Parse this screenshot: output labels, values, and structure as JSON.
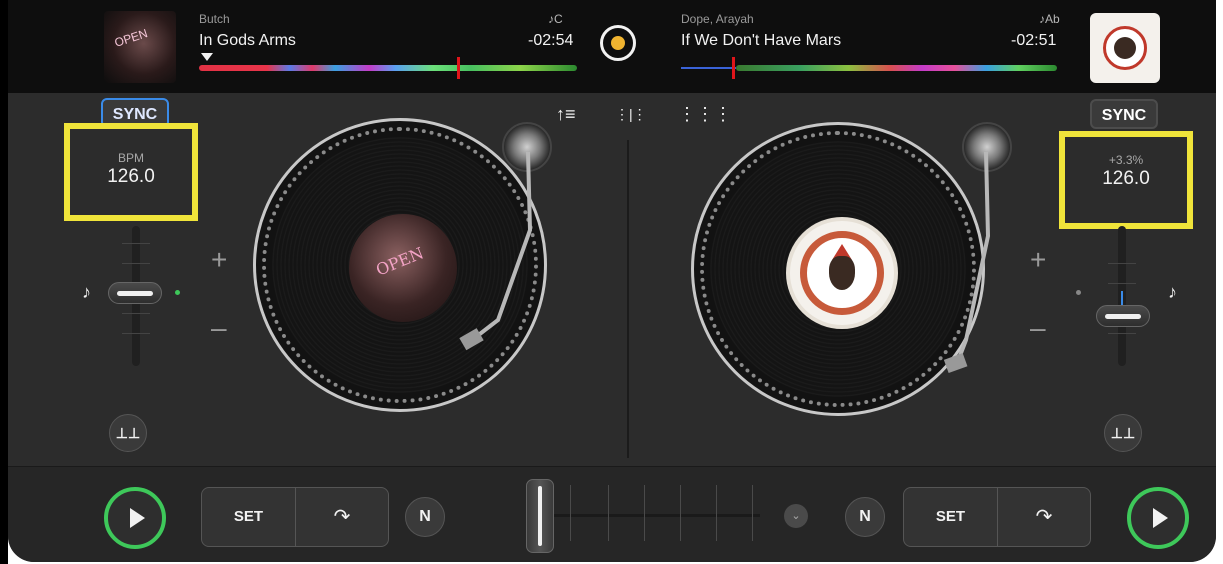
{
  "deck_left": {
    "artist": "Butch",
    "title": "In Gods Arms",
    "key": "♪C",
    "time": "-02:54",
    "sync_label": "SYNC",
    "bpm_caption": "BPM",
    "bpm_value": "126.0",
    "plus": "+",
    "minus": "–",
    "album_art_text": "OPEN",
    "record_label_text": "OPEN",
    "set_label": "SET",
    "n_label": "N",
    "eq_icon": "⊥⊥"
  },
  "deck_right": {
    "artist": "Dope, Arayah",
    "title": "If We Don't Have Mars",
    "key": "♪Ab",
    "time": "-02:51",
    "sync_label": "SYNC",
    "bpm_caption": "+3.3%",
    "bpm_value": "126.0",
    "plus": "+",
    "minus": "–",
    "set_label": "SET",
    "n_label": "N",
    "eq_icon": "⊥⊥"
  },
  "icons": {
    "note": "♪",
    "loop": "↷",
    "chevron": "⌄",
    "waveform_center": "⋮|⋮",
    "grid": "⋮⋮⋮",
    "tracklist": "↑≡"
  },
  "colors": {
    "accent_green": "#3ec85a",
    "sync_blue": "#3a8be8",
    "highlight_yellow": "#f0e43a",
    "record_orange": "#f0b430",
    "playhead_red": "#e0151a"
  }
}
